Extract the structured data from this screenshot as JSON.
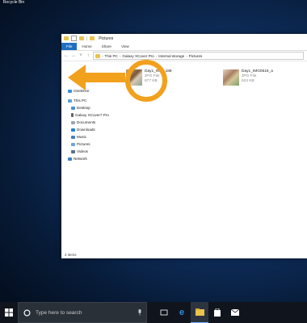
{
  "desktop": {
    "recycle_bin_label": "Recycle Bin"
  },
  "explorer": {
    "title": "Pictures",
    "ribbon_tabs": [
      "File",
      "Home",
      "Share",
      "View"
    ],
    "breadcrumb": [
      "This PC",
      "Galaxy XCover Pro",
      "Internal storage",
      "Pictures"
    ],
    "nav_items": [
      {
        "label": "OneDrive",
        "icon": "cloud-icon"
      },
      {
        "label": "This PC",
        "icon": "computer-icon"
      },
      {
        "label": "Desktop",
        "icon": "desktop-folder-icon"
      },
      {
        "label": "Galaxy XCover7 Pro",
        "icon": "phone-icon"
      },
      {
        "label": "Documents",
        "icon": "documents-icon"
      },
      {
        "label": "Downloads",
        "icon": "downloads-icon"
      },
      {
        "label": "Music",
        "icon": "music-icon"
      },
      {
        "label": "Pictures",
        "icon": "pictures-icon"
      },
      {
        "label": "Videos",
        "icon": "videos-icon"
      },
      {
        "label": "Network",
        "icon": "network-icon"
      }
    ],
    "files": [
      {
        "name": "Day1_IMG_188",
        "type": "JPG File",
        "size": "677 KB"
      },
      {
        "name": "Day1_IMG0518_a",
        "type": "JPG File",
        "size": "524 KB"
      }
    ],
    "status": "2 items"
  },
  "taskbar": {
    "search_placeholder": "Type here to search",
    "apps": [
      "task-view-icon",
      "edge-icon",
      "file-explorer-icon",
      "store-icon",
      "mail-icon"
    ]
  },
  "colors": {
    "accent": "#1f6fc1",
    "highlight_orange": "#f2a11d",
    "taskbar": "#10141c"
  }
}
